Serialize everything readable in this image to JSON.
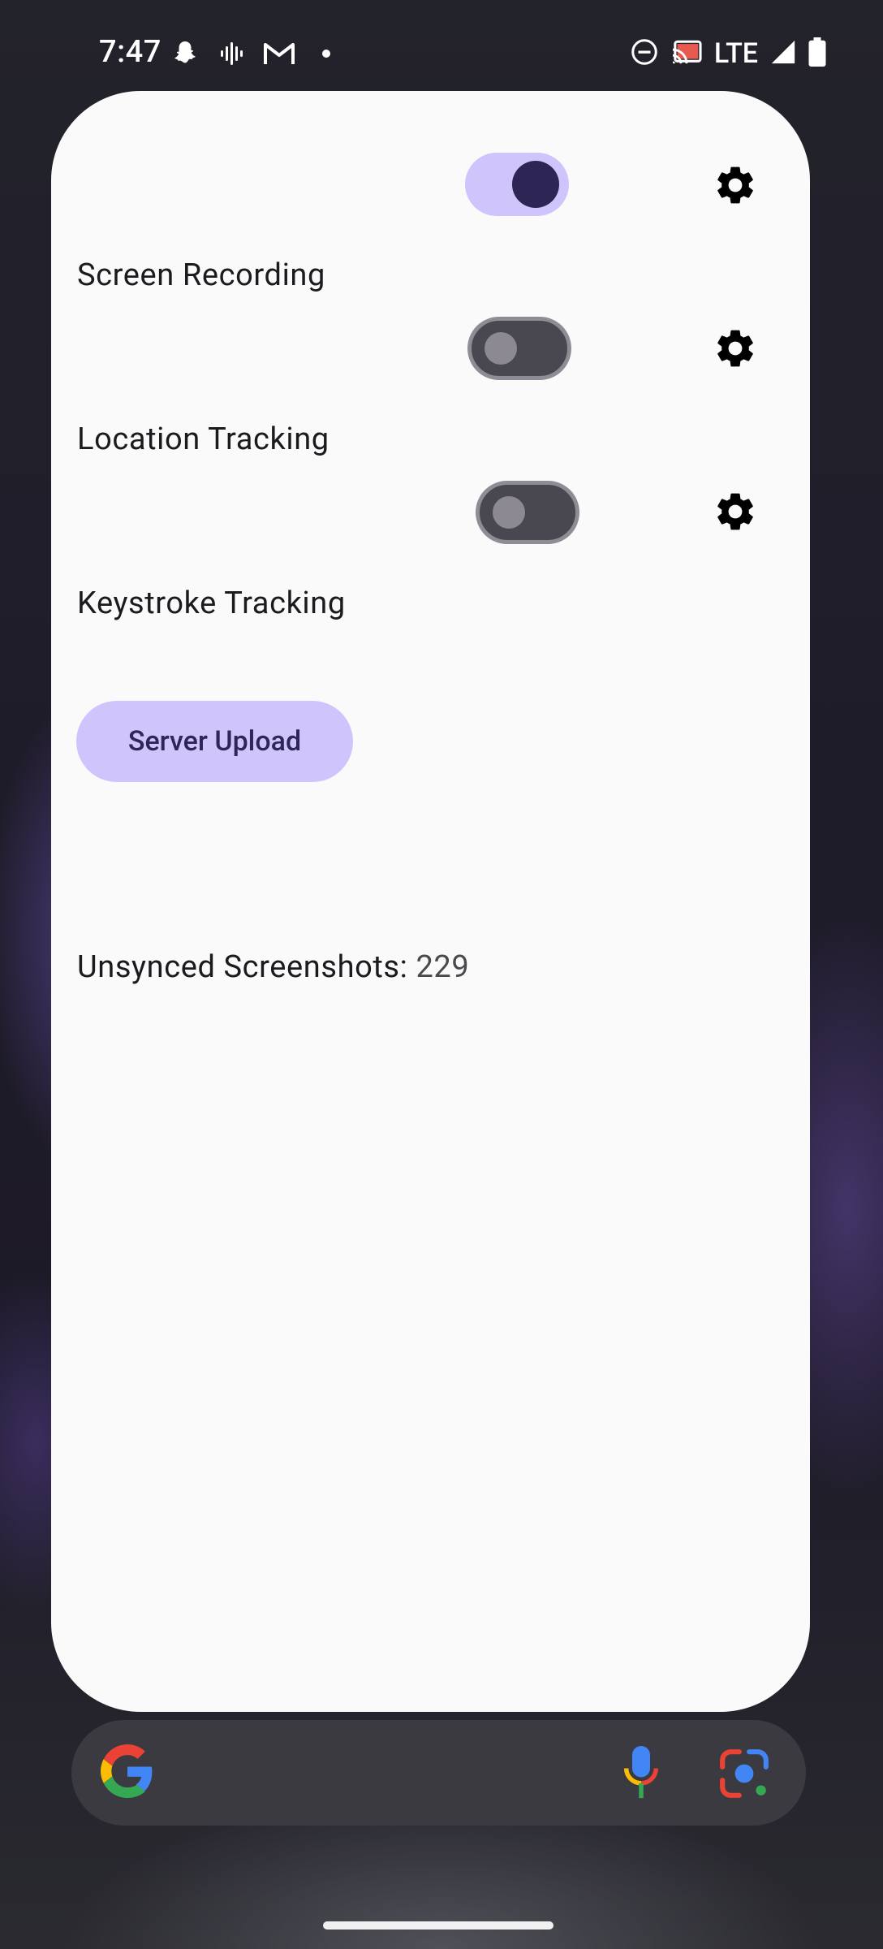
{
  "status_bar": {
    "time": "7:47",
    "network": "LTE",
    "left_icons": [
      "snapchat-icon",
      "voice-recorder-icon",
      "gmail-icon",
      "notification-dot-icon"
    ],
    "right_icons": [
      "do-not-disturb-icon",
      "cast-icon",
      "signal-icon",
      "battery-icon"
    ]
  },
  "widget": {
    "rows": [
      {
        "label": "Screen Recording",
        "enabled": true
      },
      {
        "label": "Location Tracking",
        "enabled": false
      },
      {
        "label": "Keystroke Tracking",
        "enabled": false
      }
    ],
    "upload_button": "Server Upload",
    "unsynced_label": "Unsynced Screenshots:",
    "unsynced_count": "229"
  },
  "search_bar": {
    "icons": [
      "google-logo-icon",
      "microphone-icon",
      "google-lens-icon"
    ]
  },
  "colors": {
    "accent": "#d0c4fd",
    "toggle_knob_on": "#2d2553",
    "card_background": "#fafafa"
  }
}
